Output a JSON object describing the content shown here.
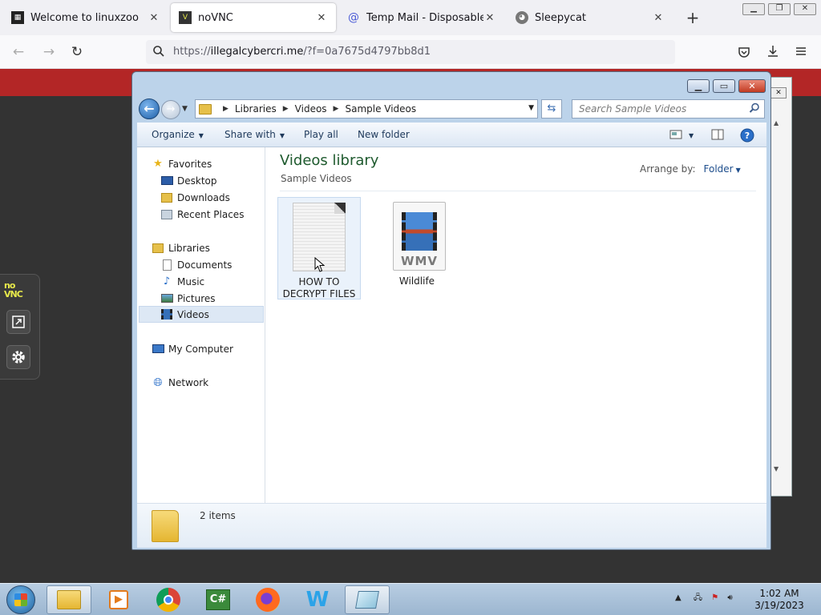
{
  "browser": {
    "tabs": [
      {
        "label": "Welcome to linuxzoo",
        "favicon": "linuxzoo-icon"
      },
      {
        "label": "noVNC",
        "favicon": "novnc-icon"
      },
      {
        "label": "Temp Mail - Disposable Temp",
        "favicon": "at-icon"
      },
      {
        "label": "Sleepycat",
        "favicon": "cat-icon"
      }
    ],
    "active_tab": 1,
    "url_prefix": "https://",
    "url_host": "illegalcybercri.me",
    "url_path": "/?f=0a7675d4797bb8d1"
  },
  "explorer": {
    "breadcrumb": [
      "Libraries",
      "Videos",
      "Sample Videos"
    ],
    "search_placeholder": "Search Sample Videos",
    "commands": {
      "organize": "Organize",
      "share_with": "Share with",
      "play_all": "Play all",
      "new_folder": "New folder"
    },
    "nav": {
      "favorites": "Favorites",
      "desktop": "Desktop",
      "downloads": "Downloads",
      "recent_places": "Recent Places",
      "libraries": "Libraries",
      "documents": "Documents",
      "music": "Music",
      "pictures": "Pictures",
      "videos": "Videos",
      "my_computer": "My Computer",
      "network": "Network"
    },
    "library_title": "Videos library",
    "library_subtitle": "Sample Videos",
    "arrange_label": "Arrange by:",
    "arrange_value": "Folder",
    "files": [
      {
        "line1": "HOW TO",
        "line2": "DECRYPT FILES"
      },
      {
        "line1": "Wildlife",
        "type_label": "WMV"
      }
    ],
    "item_count": "2 items"
  },
  "novnc": {
    "logo_top": "no",
    "logo_bottom": "VNC"
  },
  "taskbar": {
    "time": "1:02 AM",
    "date": "3/19/2023"
  },
  "colors": {
    "vnc_band": "#b32626",
    "library_title": "#1e5a2e",
    "taskbar": "#9cb6d0"
  }
}
